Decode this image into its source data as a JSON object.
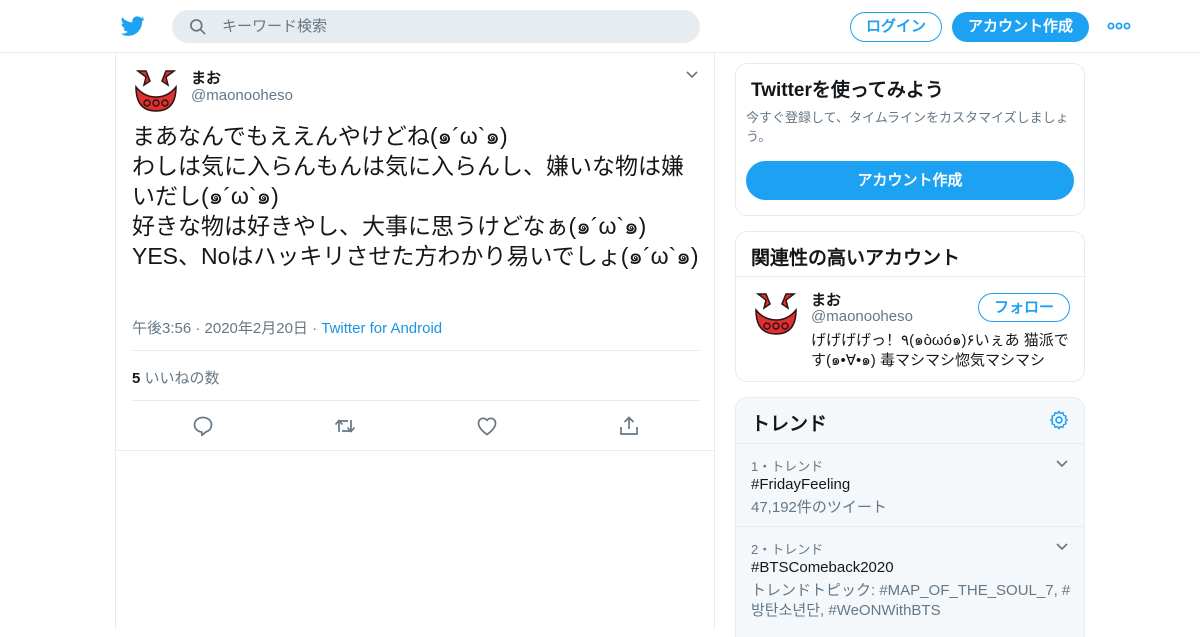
{
  "header": {
    "search_placeholder": "キーワード検索",
    "login_label": "ログイン",
    "signup_label": "アカウント作成"
  },
  "tweet": {
    "name": "まお",
    "handle": "@maonooheso",
    "text": "まあなんでもええんやけどね(๑´ω`๑)\nわしは気に入らんもんは気に入らんし、嫌いな物は嫌いだし(๑´ω`๑)\n好きな物は好きやし、大事に思うけどなぁ(๑´ω`๑)\nYES、Noはハッキリさせた方わかり易いでしょ(๑´ω`๑)",
    "time": "午後3:56 · 2020年2月20日 · ",
    "source": "Twitter for Android",
    "likes_count": "5",
    "likes_label": " いいねの数"
  },
  "signup_card": {
    "title": "Twitterを使ってみよう",
    "description": "今すぐ登録して、タイムラインをカスタマイズしましょう。",
    "button": "アカウント作成"
  },
  "related": {
    "title": "関連性の高いアカウント",
    "name": "まお",
    "handle": "@maonooheso",
    "follow_label": "フォロー",
    "bio": "げげげげっ！٩(๑òωó๑)۶いぇあ 猫派です(๑•∀•๑) 毒マシマシ惚気マシマシ"
  },
  "trends": {
    "title": "トレンド",
    "items": [
      {
        "rank": "1・トレンド",
        "name": "#FridayFeeling",
        "sub": "47,192件のツイート"
      },
      {
        "rank": "2・トレンド",
        "name": "#BTSComeback2020",
        "sub": "トレンドトピック: #MAP_OF_THE_SOUL_7, #방탄소년단, #WeONWithBTS"
      }
    ]
  },
  "colors": {
    "accent": "#1da1f2",
    "link": "#1b95e0",
    "muted": "#657786",
    "border": "#e6ecf0",
    "avatar_red": "#e0302f"
  }
}
